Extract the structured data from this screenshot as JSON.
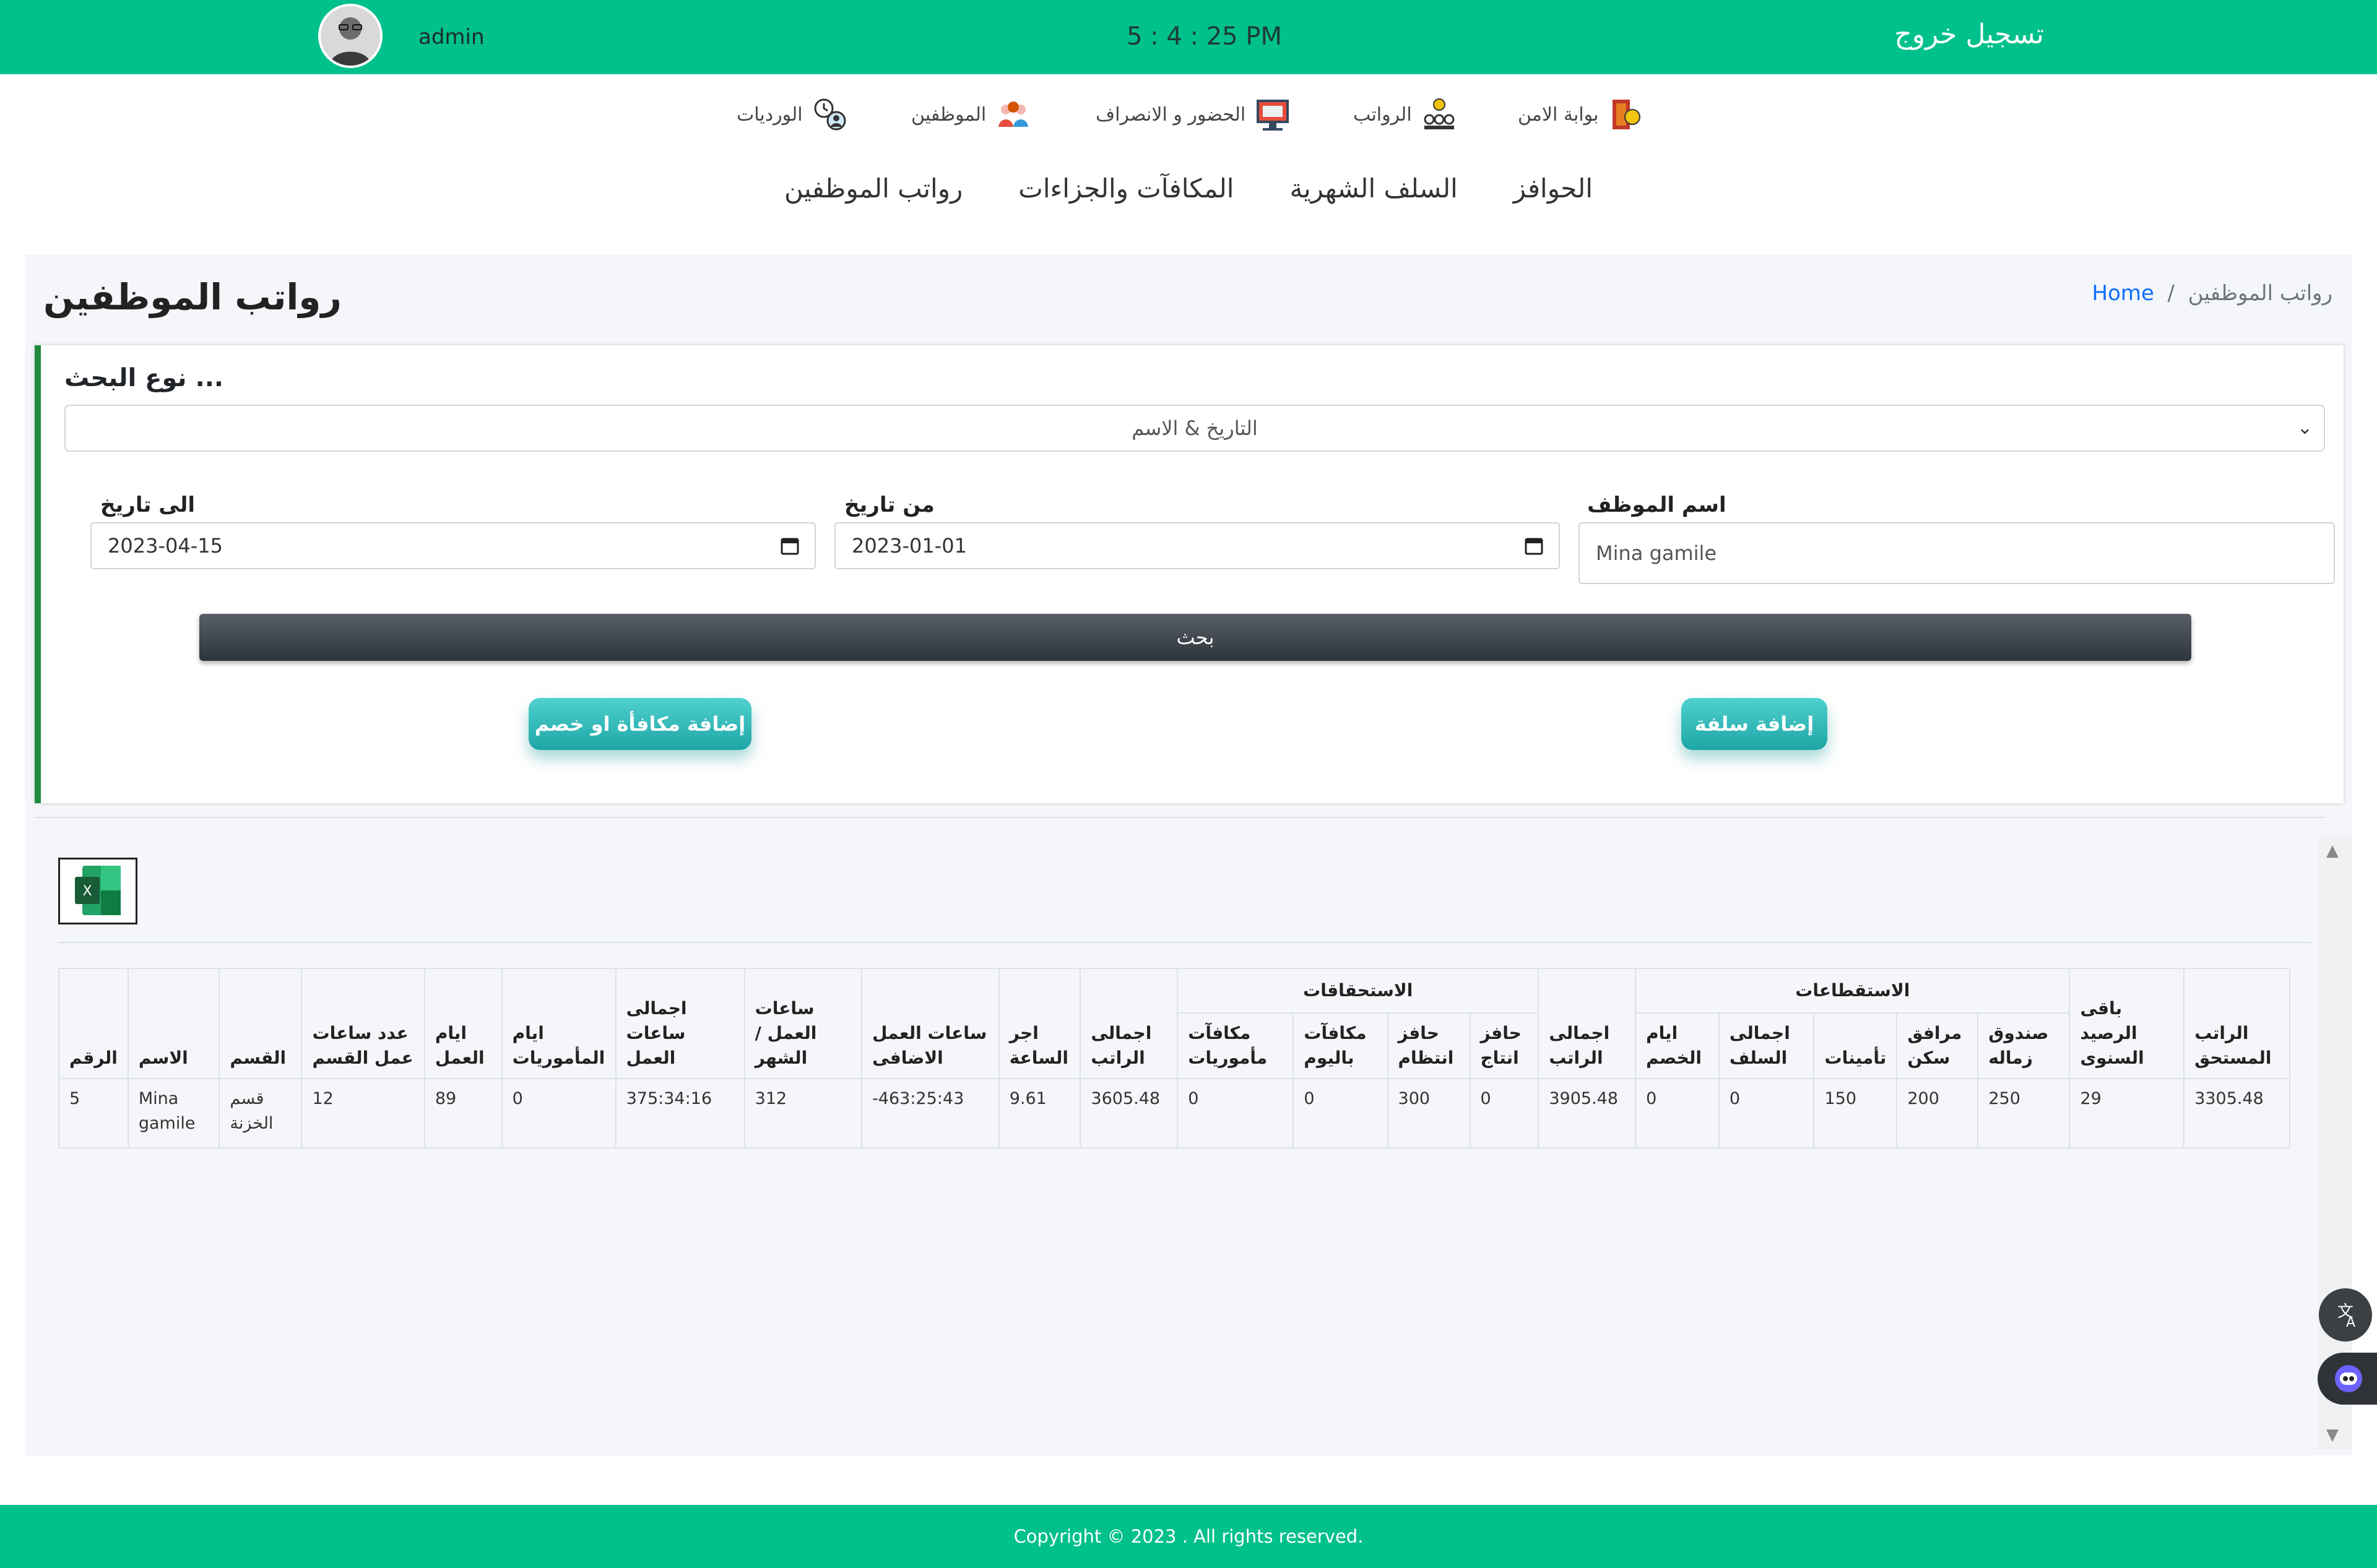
{
  "header": {
    "logout_label": "تسجيل خروج",
    "clock": "5 : 4 : 25 PM",
    "username": "admin"
  },
  "icon_nav": {
    "items": [
      {
        "label": "بوابة الامن",
        "icon": "security-gate-icon"
      },
      {
        "label": "الرواتب",
        "icon": "salaries-icon"
      },
      {
        "label": "الحضور و الانصراف",
        "icon": "attendance-icon"
      },
      {
        "label": "الموظفين",
        "icon": "employees-icon"
      },
      {
        "label": "الورديات",
        "icon": "shifts-icon"
      }
    ]
  },
  "sub_menu": {
    "items": [
      "الحوافز",
      "السلف الشهرية",
      "المكافآت والجزاءات",
      "رواتب الموظفين"
    ]
  },
  "breadcrumb": {
    "home": "Home",
    "separator": "/",
    "current": "رواتب الموظفين"
  },
  "page_title": "رواتب الموظفين",
  "search": {
    "type_label": "نوع البحث ...",
    "type_value": "التاريخ & الاسم",
    "to_date_label": "الى تاريخ",
    "to_date_value": "2023-04-15",
    "from_date_label": "من تاريخ",
    "from_date_value": "2023-01-01",
    "employee_label": "اسم الموظف",
    "employee_value": "Mina gamile",
    "search_button": "بحث",
    "add_reward_button": "إضافة مكافأة او خصم",
    "add_advance_button": "إضافة سلفة"
  },
  "table": {
    "group_entitlements": "الاستحقاقات",
    "group_deductions": "الاستقطاعات",
    "headers": {
      "num": "الرقم",
      "name": "الاسم",
      "dept": "القسم",
      "dept_hours": "عدد ساعات عمل القسم",
      "work_days": "ايام العمل",
      "mission_days": "ايام المأموريات",
      "total_work_hours": "اجمالى ساعات العمل",
      "monthly_hours": "ساعات العمل / الشهر",
      "overtime_hours": "ساعات العمل الاضافى",
      "hour_rate": "اجر الساعة",
      "gross_salary": "اجمالى الراتب",
      "mission_rewards": "مكافآت مأموريات",
      "daily_rewards": "مكافآت باليوم",
      "discipline_bonus": "حافز انتظام",
      "production_bonus": "حافز انتاج",
      "total_salary": "اجمالى الراتب",
      "deduction_days": "ايام الخصم",
      "total_advances": "اجمالى السلف",
      "insurance": "تأمينات",
      "housing": "مرافق سكن",
      "colleague_fund": "صندوق زماله",
      "annual_balance": "باقى الرصيد السنوى",
      "net_salary": "الراتب المستحق"
    },
    "rows": [
      {
        "num": "5",
        "name": "Mina gamile",
        "dept": "قسم الخزنة",
        "dept_hours": "12",
        "work_days": "89",
        "mission_days": "0",
        "total_work_hours": "375:34:16",
        "monthly_hours": "312",
        "overtime_hours": "-463:25:43",
        "hour_rate": "9.61",
        "gross_salary": "3605.48",
        "mission_rewards": "0",
        "daily_rewards": "0",
        "discipline_bonus": "300",
        "production_bonus": "0",
        "total_salary": "3905.48",
        "deduction_days": "0",
        "total_advances": "0",
        "insurance": "150",
        "housing": "200",
        "colleague_fund": "250",
        "annual_balance": "29",
        "net_salary": "3305.48"
      }
    ]
  },
  "footer": {
    "copyright": "Copyright © 2023 . All rights reserved."
  },
  "colors": {
    "brand": "#00c08b",
    "accent_teal": "#1ea6a5",
    "card_border": "#1f8a3a",
    "link": "#0d6efd"
  }
}
